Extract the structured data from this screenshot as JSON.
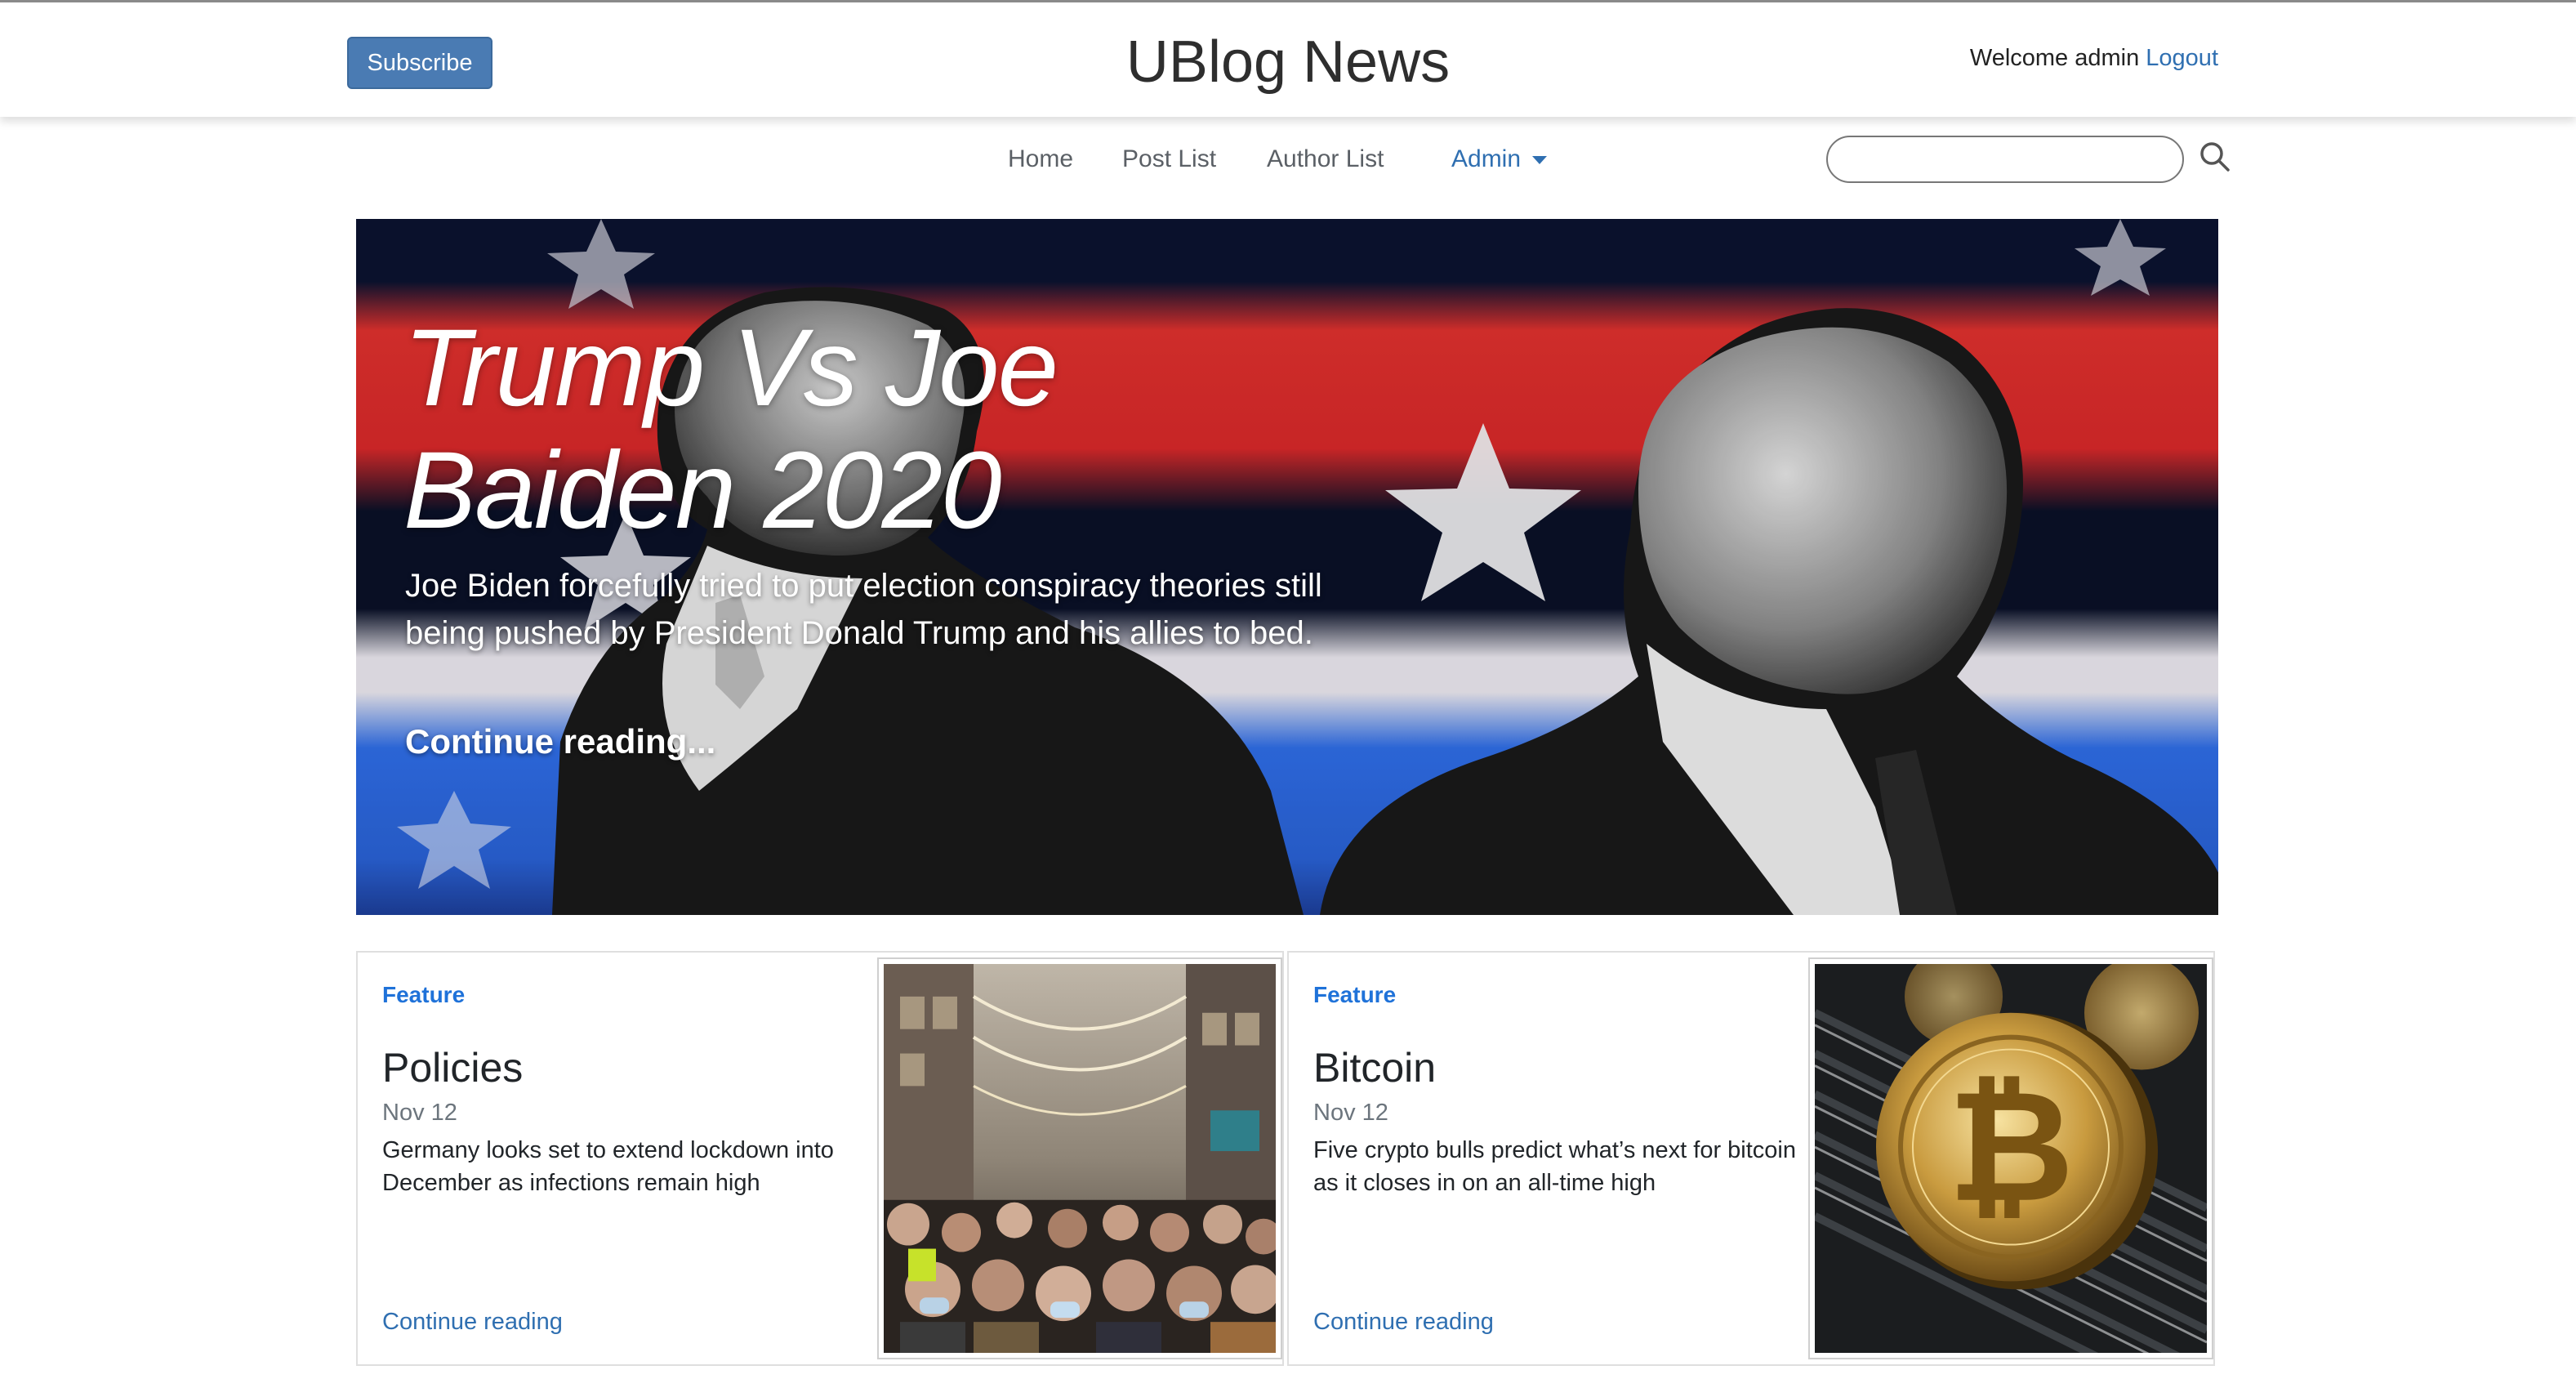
{
  "header": {
    "subscribe_label": "Subscribe",
    "brand": "UBlog News",
    "welcome_text": "Welcome admin",
    "logout_label": "Logout"
  },
  "nav": {
    "items": [
      {
        "label": "Home"
      },
      {
        "label": "Post List"
      },
      {
        "label": "Author List"
      },
      {
        "label": "Admin"
      }
    ]
  },
  "search": {
    "value": "",
    "icon": "search-icon"
  },
  "hero": {
    "title": "Trump Vs Joe Baiden 2020",
    "excerpt": "Joe Biden forcefully tried to put election conspiracy theories still being pushed by President Donald Trump and his allies to bed.",
    "link_label": "Continue reading...",
    "image_desc": "Black-and-white portraits of Trump and Biden over a red, white and blue flag background"
  },
  "cards": [
    {
      "category": "Feature",
      "title": "Policies",
      "date": "Nov 12",
      "text": "Germany looks set to extend lockdown into December as infections remain high",
      "link_label": "Continue reading"
    },
    {
      "category": "Feature",
      "title": "Bitcoin",
      "date": "Nov 12",
      "text": "Five crypto bulls predict what’s next for bitcoin as it closes in on an all-time high",
      "link_label": "Continue reading"
    }
  ],
  "colors": {
    "link": "#2f6fb1",
    "subscribe_bg": "#4a7bb3",
    "category": "#1f72d9",
    "flag_red": "#e0312e",
    "flag_blue": "#2f6ee8",
    "flag_navy": "#0b1330"
  }
}
